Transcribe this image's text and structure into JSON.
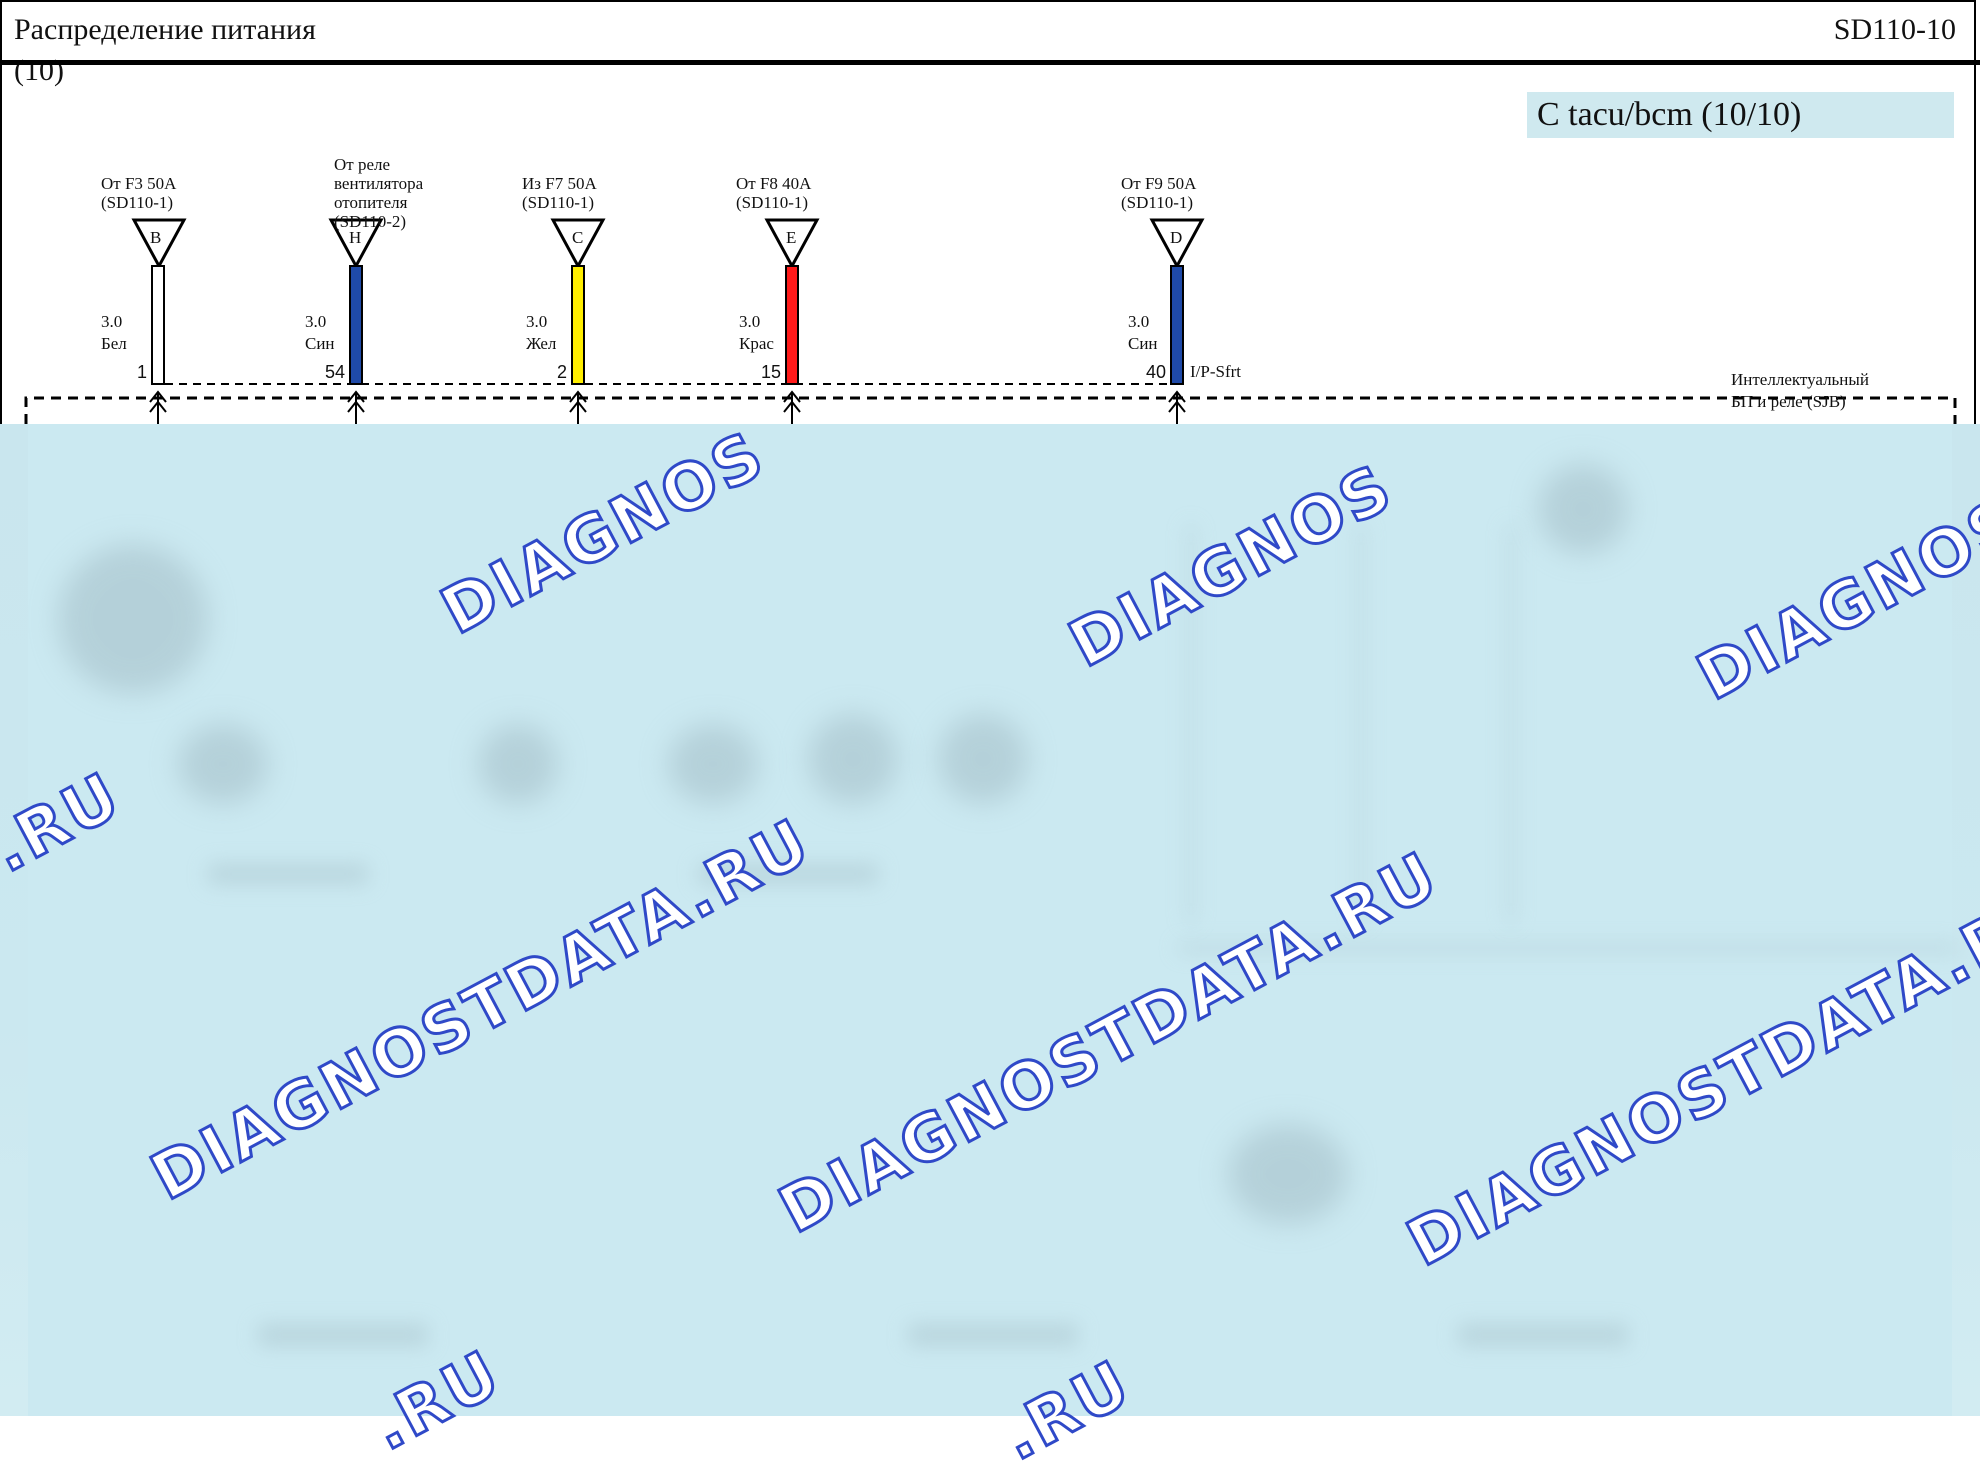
{
  "header": {
    "title": "Распределение питания",
    "subtitle": "(10)",
    "page_code": "SD110-10"
  },
  "option_label": "С tacu/bcm (10/10)",
  "connectors": [
    {
      "letter": "B",
      "source": "От F3 50A\n(SD110-1)",
      "gauge": "3.0",
      "color_name": "Бел",
      "pin": "1",
      "wire_color": "#ffffff"
    },
    {
      "letter": "H",
      "source": "От реле\nвентилятора\nотопителя\n(SD110-2)",
      "gauge": "3.0",
      "color_name": "Син",
      "pin": "54",
      "wire_color": "#1f4aa8"
    },
    {
      "letter": "C",
      "source": "Из F7 50A\n(SD110-1)",
      "gauge": "3.0",
      "color_name": "Жел",
      "pin": "2",
      "wire_color": "#ffee00"
    },
    {
      "letter": "E",
      "source": "От F8 40A\n(SD110-1)",
      "gauge": "3.0",
      "color_name": "Крас",
      "pin": "15",
      "wire_color": "#ff1a1a"
    },
    {
      "letter": "D",
      "source": "От F9 50A\n(SD110-1)",
      "gauge": "3.0",
      "color_name": "Син",
      "pin": "40",
      "wire_color": "#1f4aa8"
    }
  ],
  "ip_label": "I/P-Sfrt",
  "sjb_label": "Интеллектуальный\nБП и реле (SJB)",
  "watermark": {
    "short": "DIAGNOS",
    "domain": "DIAGNOSTDATA.RU",
    "tail": ".RU",
    "color": "#2f49c8"
  }
}
